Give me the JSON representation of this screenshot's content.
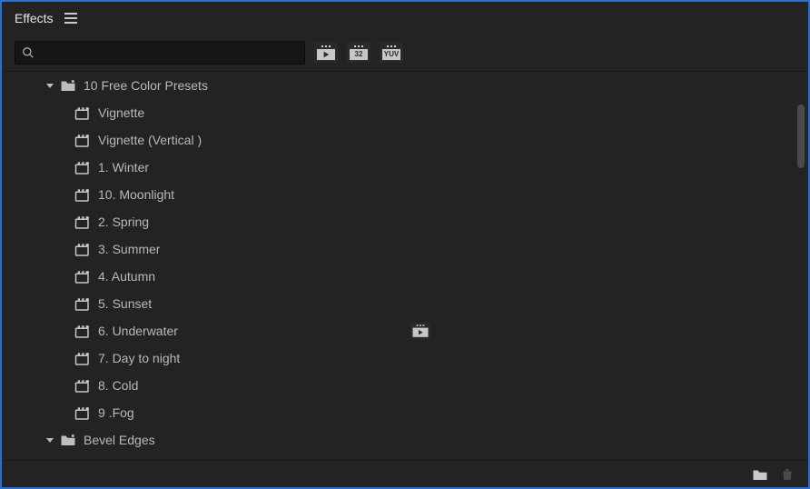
{
  "panel": {
    "title": "Effects"
  },
  "search": {
    "value": "",
    "placeholder": ""
  },
  "filters": {
    "accelerated": "▶",
    "bit32": "32",
    "yuv": "YUV"
  },
  "folders": [
    {
      "name": "10 Free Color Presets",
      "expanded": true,
      "items": [
        {
          "label": "Vignette",
          "accelerated": false
        },
        {
          "label": "Vignette (Vertical )",
          "accelerated": false
        },
        {
          "label": "1. Winter",
          "accelerated": false
        },
        {
          "label": "10. Moonlight",
          "accelerated": false
        },
        {
          "label": "2. Spring",
          "accelerated": false
        },
        {
          "label": "3. Summer",
          "accelerated": false
        },
        {
          "label": "4. Autumn",
          "accelerated": false
        },
        {
          "label": "5. Sunset",
          "accelerated": false
        },
        {
          "label": "6. Underwater",
          "accelerated": true
        },
        {
          "label": "7. Day to night",
          "accelerated": false
        },
        {
          "label": "8. Cold",
          "accelerated": false
        },
        {
          "label": "9 .Fog",
          "accelerated": false
        }
      ]
    },
    {
      "name": "Bevel Edges",
      "expanded": true,
      "items": []
    }
  ]
}
